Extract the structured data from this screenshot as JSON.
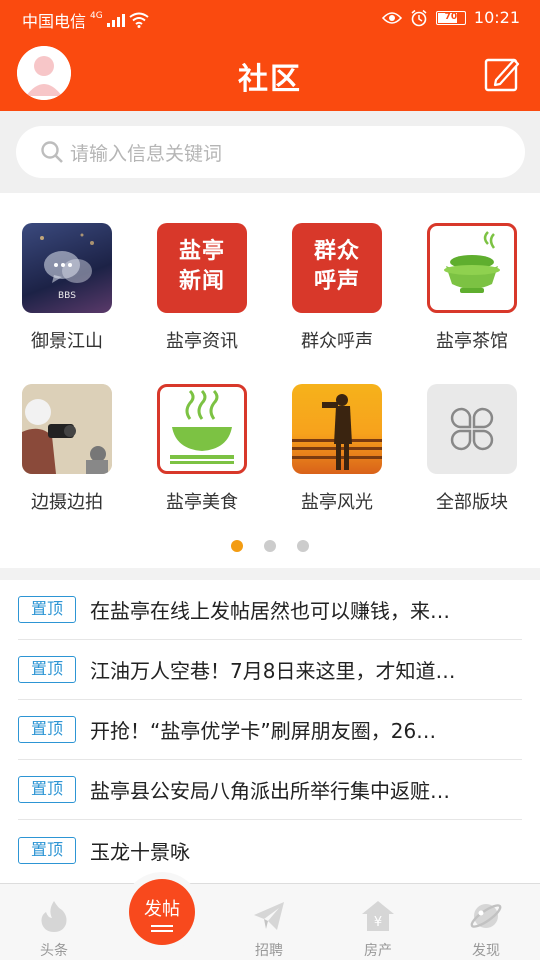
{
  "status_bar": {
    "carrier": "中国电信",
    "network": "4G",
    "battery": "70",
    "time": "10:21"
  },
  "header": {
    "title": "社区"
  },
  "search": {
    "placeholder": "请输入信息关键词"
  },
  "grid": {
    "items": [
      {
        "label": "御景江山",
        "icon": "chat-bubbles-bbs-icon",
        "icon_text": "BBS"
      },
      {
        "label": "盐亭资讯",
        "icon": "news-icon",
        "icon_text": "盐亭新闻"
      },
      {
        "label": "群众呼声",
        "icon": "public-voice-icon",
        "icon_text": "群众呼声"
      },
      {
        "label": "盐亭茶馆",
        "icon": "teacup-icon"
      },
      {
        "label": "边摄边拍",
        "icon": "photographer-icon"
      },
      {
        "label": "盐亭美食",
        "icon": "food-bowl-icon"
      },
      {
        "label": "盐亭风光",
        "icon": "scenery-icon"
      },
      {
        "label": "全部版块",
        "icon": "all-sections-icon"
      }
    ],
    "page_count": 3,
    "active_page": 1
  },
  "pinned": {
    "tag": "置顶",
    "items": [
      "在盐亭在线上发帖居然也可以赚钱，来…",
      "江油万人空巷！7月8日来这里，才知道…",
      "开抢！“盐亭优学卡”刷屏朋友圈，26…",
      "盐亭县公安局八角派出所举行集中返赃…",
      "玉龙十景咏"
    ]
  },
  "nav": {
    "headlines": "头条",
    "post": "发帖",
    "jobs": "招聘",
    "property": "房产",
    "discover": "发现"
  },
  "colors": {
    "brand": "#fa4a0f",
    "tag_blue": "#2d95d4",
    "dot_active": "#f39c12"
  }
}
